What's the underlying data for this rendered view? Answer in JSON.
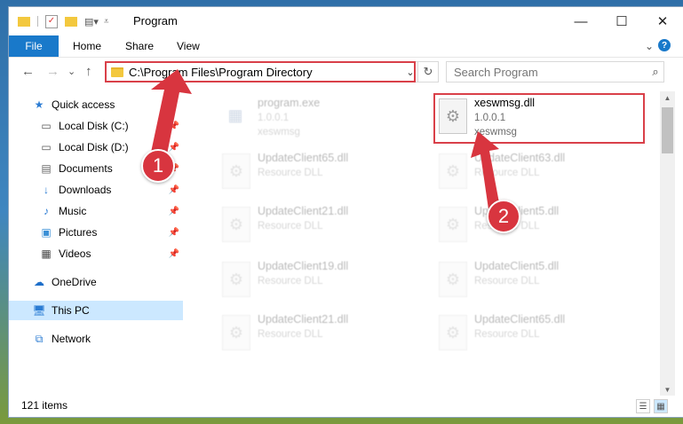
{
  "window": {
    "title": "Program",
    "minimize": "—",
    "maximize": "☐",
    "close": "✕"
  },
  "ribbon": {
    "file": "File",
    "tabs": [
      "Home",
      "Share",
      "View"
    ],
    "expand": "⌄",
    "help": "?"
  },
  "nav": {
    "back": "←",
    "forward": "→",
    "recent": "⌄",
    "up": "↑",
    "address": "C:\\Program Files\\Program Directory",
    "address_dropdown": "⌄",
    "refresh": "↻",
    "search_placeholder": "Search Program",
    "search_icon": "search-icon"
  },
  "sidebar": [
    {
      "label": "Quick access",
      "icon": "star-icon",
      "pinned": false
    },
    {
      "label": "Local Disk (C:)",
      "icon": "drive-icon",
      "pinned": true
    },
    {
      "label": "Local Disk (D:)",
      "icon": "drive-icon",
      "pinned": true
    },
    {
      "label": "Documents",
      "icon": "documents-icon",
      "pinned": true
    },
    {
      "label": "Downloads",
      "icon": "download-icon",
      "pinned": true
    },
    {
      "label": "Music",
      "icon": "music-icon",
      "pinned": true
    },
    {
      "label": "Pictures",
      "icon": "pictures-icon",
      "pinned": true
    },
    {
      "label": "Videos",
      "icon": "videos-icon",
      "pinned": true
    },
    {
      "label": "OneDrive",
      "icon": "cloud-icon",
      "pinned": false
    },
    {
      "label": "This PC",
      "icon": "pc-icon",
      "pinned": false,
      "selected": true
    },
    {
      "label": "Network",
      "icon": "network-icon",
      "pinned": false
    }
  ],
  "files": [
    {
      "name": "program.exe",
      "line2": "1.0.0.1",
      "line3": "xeswmsg",
      "highlighted": false
    },
    {
      "name": "xeswmsg.dll",
      "line2": "1.0.0.1",
      "line3": "xeswmsg",
      "highlighted": true
    },
    {
      "name": "UpdateClient65.dll",
      "line2": "Resource DLL",
      "line3": "",
      "highlighted": false
    },
    {
      "name": "UpdateClient63.dll",
      "line2": "Resource DLL",
      "line3": "",
      "highlighted": false
    },
    {
      "name": "UpdateClient21.dll",
      "line2": "Resource DLL",
      "line3": "",
      "highlighted": false
    },
    {
      "name": "UpdateClient5.dll",
      "line2": "Resource DLL",
      "line3": "",
      "highlighted": false
    },
    {
      "name": "UpdateClient19.dll",
      "line2": "Resource DLL",
      "line3": "",
      "highlighted": false
    },
    {
      "name": "UpdateClient5.dll",
      "line2": "Resource DLL",
      "line3": "",
      "highlighted": false
    },
    {
      "name": "UpdateClient21.dll",
      "line2": "Resource DLL",
      "line3": "",
      "highlighted": false
    },
    {
      "name": "UpdateClient65.dll",
      "line2": "Resource DLL",
      "line3": "",
      "highlighted": false
    }
  ],
  "status": {
    "count": "121 items"
  },
  "annotations": {
    "step1": "1",
    "step2": "2",
    "color": "#d8353f"
  }
}
